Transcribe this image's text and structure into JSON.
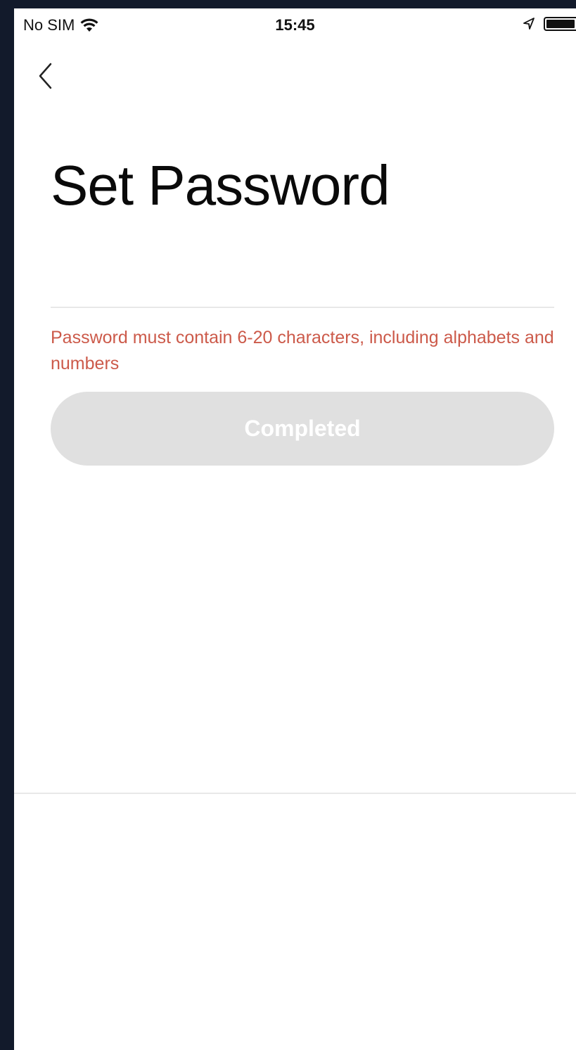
{
  "status_bar": {
    "carrier": "No SIM",
    "time": "15:45"
  },
  "header": {
    "back_icon": "chevron-left-icon"
  },
  "main": {
    "title": "Set Password",
    "password_field": {
      "value": "",
      "placeholder": ""
    },
    "hint": "Password must contain 6-20 characters, including alphabets and numbers",
    "completed_button_label": "Completed"
  },
  "colors": {
    "hint": "#cc5a4a",
    "button_disabled_bg": "#e0e0e0",
    "frame": "#121a2b"
  }
}
